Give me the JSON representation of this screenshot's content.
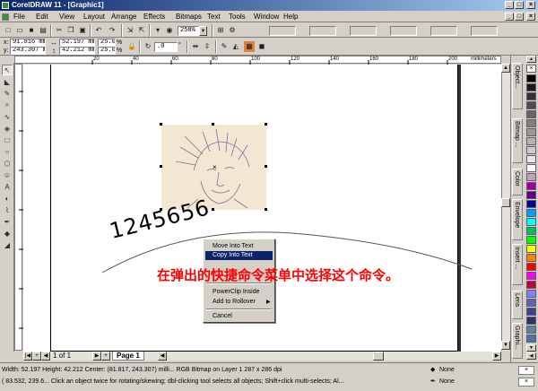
{
  "window": {
    "title": "CorelDRAW 11 - [Graphic1]"
  },
  "menu": [
    "File",
    "Edit",
    "View",
    "Layout",
    "Arrange",
    "Effects",
    "Bitmaps",
    "Text",
    "Tools",
    "Window",
    "Help"
  ],
  "toolbar": {
    "zoom": "258%"
  },
  "property_bar": {
    "x": "91.816 mm",
    "y": "243.307 mm",
    "width": "52.197 mm",
    "height": "42.212 mm",
    "scale_w": "25.0",
    "scale_h": "25.0",
    "angle": ".0"
  },
  "ruler": {
    "unit": "millimeters",
    "h_ticks": [
      "20",
      "40",
      "60",
      "80",
      "100",
      "120",
      "140",
      "160",
      "180",
      "200"
    ]
  },
  "canvas": {
    "text_on_path": "1245656"
  },
  "context_menu": {
    "items": [
      "Move Into Text",
      "Copy Into Text",
      "PowerClip Inside",
      "Add to Rollover",
      "Cancel"
    ],
    "highlighted": "Copy Into Text"
  },
  "caption": "在弹出的快捷命令菜单中选择这个命令。",
  "page_nav": {
    "counter": "1 of 1",
    "page_tab": "Page 1"
  },
  "dockers": [
    "Object...",
    "Bitmap ...",
    "Color",
    "Envelope",
    "Insert ...",
    "Lens",
    "Graphi..."
  ],
  "status": {
    "line1": "Width: 52.197  Height: 42.212  Center: (81.817, 243.307)  milli...   RGB Bitmap on Layer 1 287 x 286 dpi",
    "line2": "( 83.532, 239.6...   Click an object twice for rotating/skewing; dbl-clicking tool selects all objects; Shift+click multi-selects; Al...",
    "fill": "None",
    "outline": "None"
  },
  "colors": {
    "title_start": "#0a246a",
    "title_end": "#a6caf0",
    "highlight": "#0a246a",
    "caption": "#ff0000"
  }
}
